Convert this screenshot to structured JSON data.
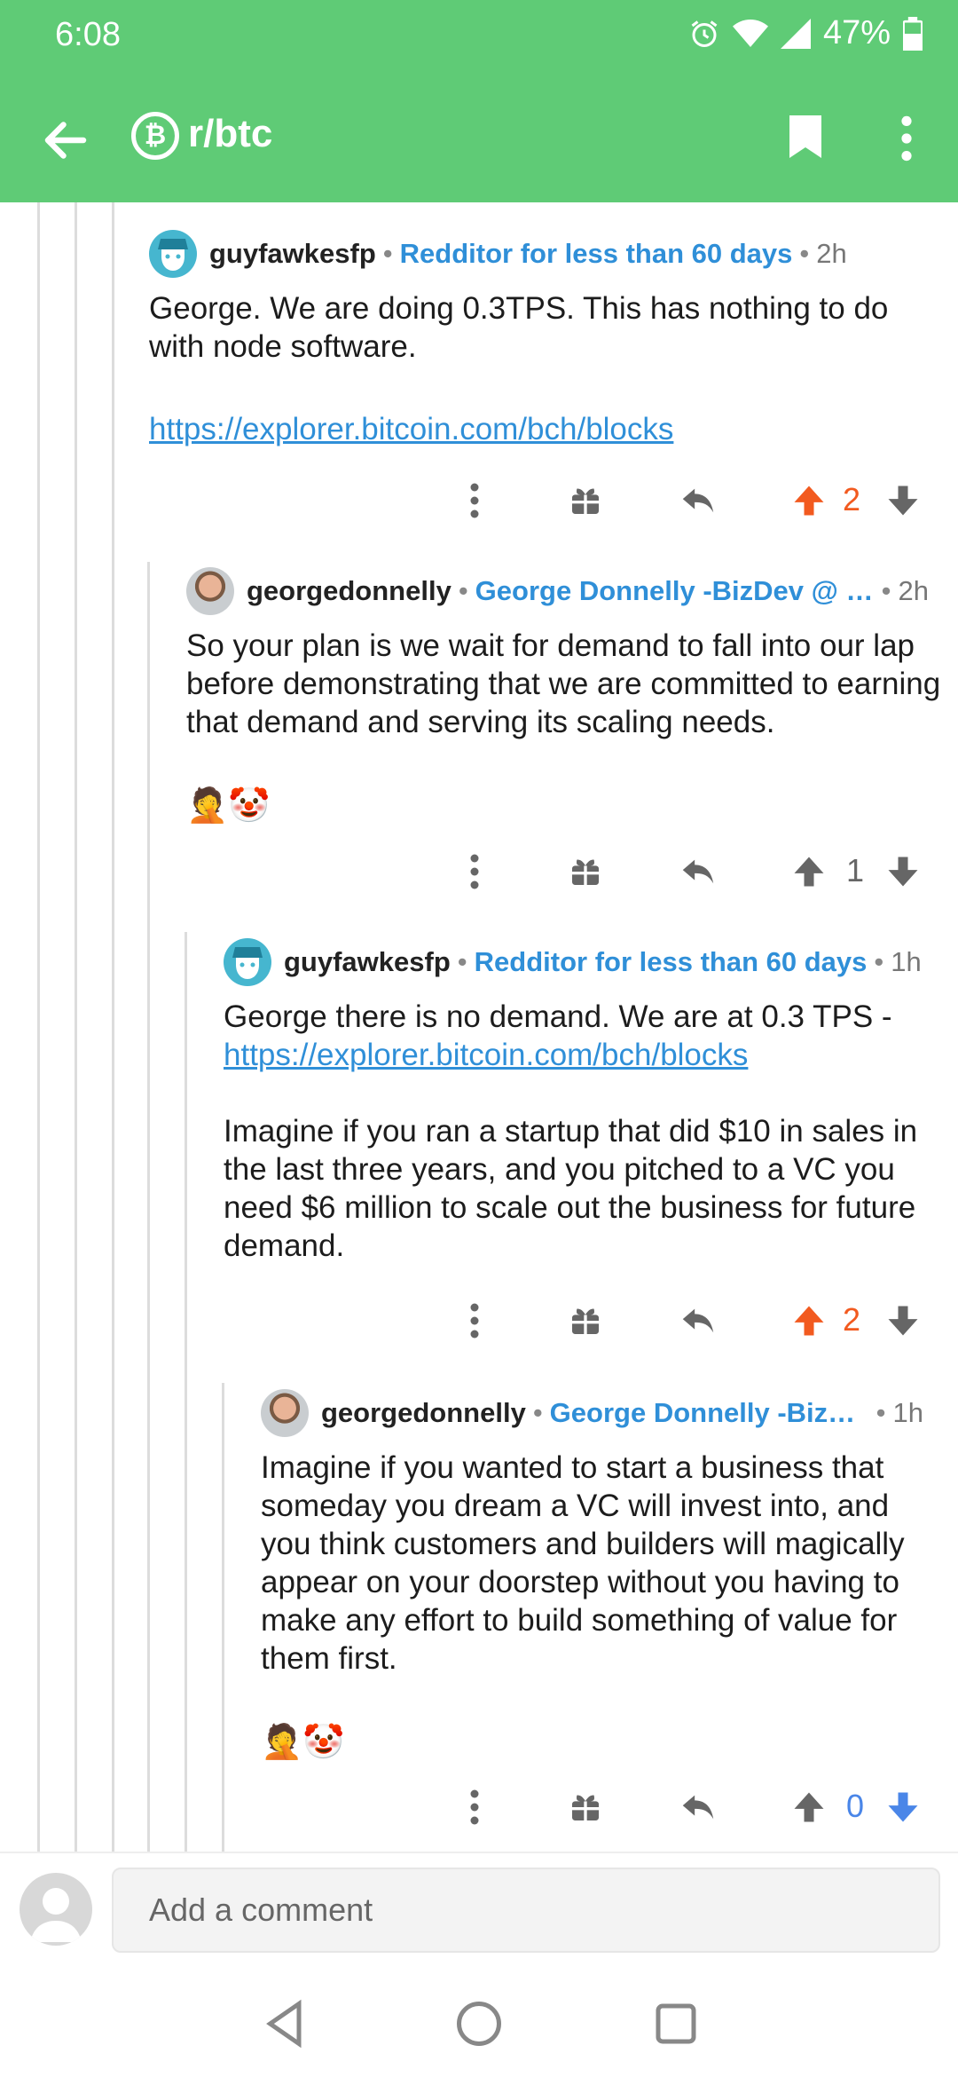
{
  "status_bar": {
    "time": "6:08",
    "battery": "47%"
  },
  "app_bar": {
    "subreddit": "r/btc",
    "subreddit_icon_letter": "₿"
  },
  "comments": [
    {
      "author": "guyfawkesfp",
      "flair": "Redditor for less than 60 days",
      "age": "2h",
      "paragraphs": [
        "George. We are doing 0.3TPS. This has nothing to do with node software."
      ],
      "link": "https://explorer.bitcoin.com/bch/blocks",
      "score": "2"
    },
    {
      "author": "georgedonnelly",
      "flair": "George Donnelly -BizDev @ Bi…",
      "age": "2h",
      "paragraphs": [
        "So your plan is we wait for demand to fall into our lap before demonstrating that we are committed to earning that demand and serving its scaling needs."
      ],
      "emoji": "🤦🤡",
      "score": "1"
    },
    {
      "author": "guyfawkesfp",
      "flair": "Redditor for less than 60 days",
      "age": "1h",
      "line1": "George there is no demand. We are at 0.3 TPS -",
      "link": "https://explorer.bitcoin.com/bch/blocks",
      "paragraphs": [
        "Imagine if you ran a startup that did $10 in sales in the last three years, and you pitched to a VC you need $6 million to scale out the business for future demand."
      ],
      "score": "2"
    },
    {
      "author": "georgedonnelly",
      "flair": "George Donnelly -BizDe…",
      "age": "1h",
      "paragraphs": [
        "Imagine if you wanted to start a business that someday you dream a VC will invest into, and you think customers and builders will magically appear on your doorstep without you having to make any effort to build something of value for them first."
      ],
      "emoji": "🤦🤡",
      "score": "0"
    }
  ],
  "comment_bar": {
    "placeholder": "Add a comment"
  },
  "colors": {
    "green": "#5fcb76",
    "orange": "#f25a1f",
    "blue": "#4a86e8",
    "flair": "#2f8fd8"
  }
}
